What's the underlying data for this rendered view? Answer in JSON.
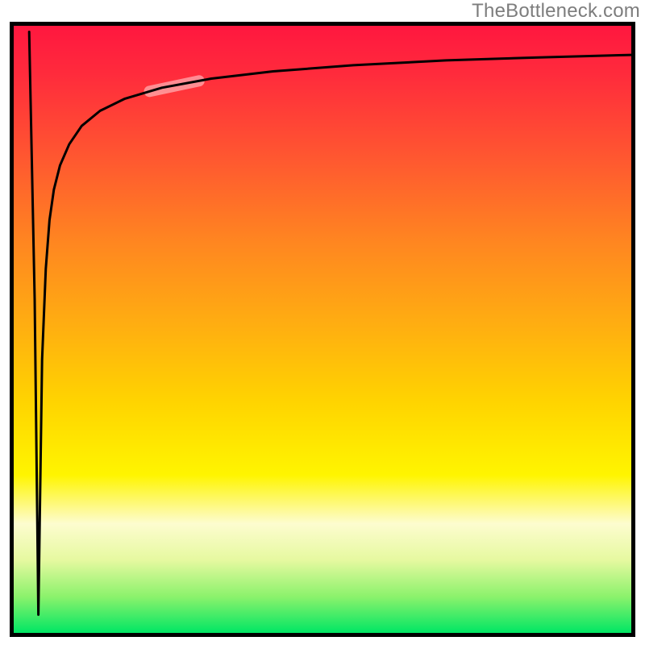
{
  "attribution": "TheBottleneck.com",
  "chart_data": {
    "type": "line",
    "title": "",
    "xlabel": "",
    "ylabel": "",
    "xlim": [
      0,
      100
    ],
    "ylim": [
      0,
      100
    ],
    "gradient_stops": [
      {
        "pos": 0,
        "color": "#ff173f"
      },
      {
        "pos": 8,
        "color": "#ff2b3c"
      },
      {
        "pos": 22,
        "color": "#ff5830"
      },
      {
        "pos": 36,
        "color": "#ff8720"
      },
      {
        "pos": 50,
        "color": "#ffb010"
      },
      {
        "pos": 62,
        "color": "#ffd400"
      },
      {
        "pos": 74,
        "color": "#fff500"
      },
      {
        "pos": 82,
        "color": "#fdfccf"
      },
      {
        "pos": 88,
        "color": "#e6f9a0"
      },
      {
        "pos": 94,
        "color": "#8cf26c"
      },
      {
        "pos": 100,
        "color": "#00e664"
      }
    ],
    "series": [
      {
        "name": "bottleneck-curve",
        "x": [
          2.5,
          3.4,
          4.0,
          4.6,
          5.2,
          5.8,
          6.5,
          7.5,
          9.0,
          11.0,
          14.0,
          18.0,
          24.0,
          32.0,
          42.0,
          55.0,
          70.0,
          85.0,
          100.0
        ],
        "y": [
          99.0,
          55.0,
          3.0,
          45.0,
          60.0,
          68.0,
          73.0,
          77.0,
          80.5,
          83.5,
          86.0,
          88.0,
          89.8,
          91.3,
          92.5,
          93.5,
          94.3,
          94.8,
          95.2
        ]
      }
    ],
    "highlight_segment": {
      "x_start": 22,
      "x_end": 30
    },
    "frame_color": "#000000",
    "curve_color": "#000000",
    "highlight_color": "rgba(255,255,255,0.45)"
  }
}
